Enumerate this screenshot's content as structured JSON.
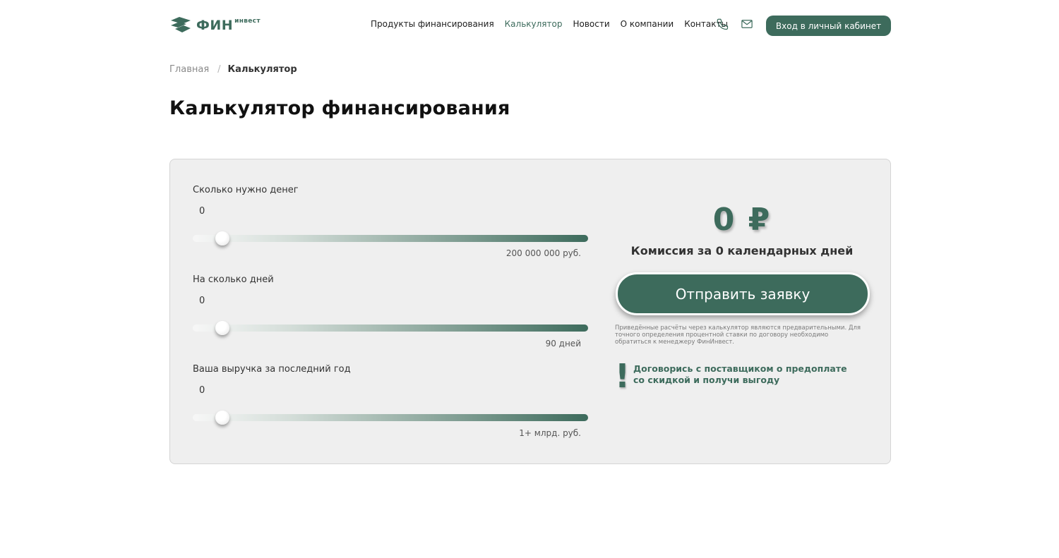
{
  "header": {
    "logo": {
      "main": "ФИН",
      "sup": "инвест"
    },
    "nav": [
      {
        "label": "Продукты финансирования",
        "active": false
      },
      {
        "label": "Калькулятор",
        "active": true
      },
      {
        "label": "Новости",
        "active": false
      },
      {
        "label": "О компании",
        "active": false
      },
      {
        "label": "Контакты",
        "active": false
      }
    ],
    "icons": [
      "phone-icon",
      "mail-icon"
    ],
    "login_label": "Вход в личный кабинет"
  },
  "breadcrumb": {
    "home": "Главная",
    "separator": "/",
    "current": "Калькулятор"
  },
  "page_title": "Калькулятор финансирования",
  "calculator": {
    "fields": [
      {
        "label": "Сколько нужно денег",
        "value": "0",
        "max_label": "200 000 000 руб.",
        "position": 0
      },
      {
        "label": "На сколько дней",
        "value": "0",
        "max_label": "90 дней",
        "position": 0
      },
      {
        "label": "Ваша выручка за последний год",
        "value": "0",
        "max_label": "1+ млрд. руб.",
        "position": 0
      }
    ],
    "result_amount": "0 ₽",
    "result_caption": "Комиссия за 0 календарных дней",
    "submit_label": "Отправить заявку",
    "disclaimer": "Приведённые расчёты через калькулятор являются предварительными. Для точного определения процентной ставки по договору необходимо обратиться к менеджеру ФинИнвест.",
    "promo_mark": "!",
    "promo_text": "Договорись с поставщиком о предоплате со скидкой и получи выгоду"
  },
  "colors": {
    "accent": "#3d6b5c",
    "panel_bg": "#efefef",
    "text": "#1d1d1d"
  }
}
